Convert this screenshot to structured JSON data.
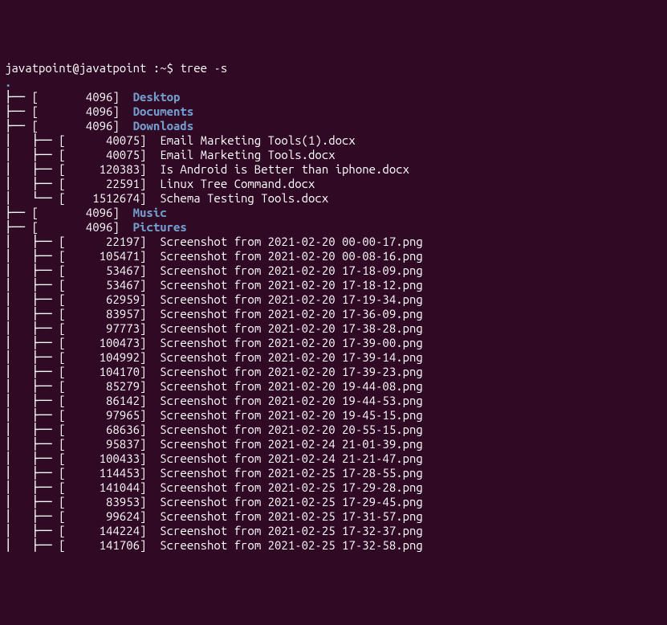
{
  "prompt": {
    "user": "javatpoint@javatpoint",
    "sep": " :",
    "path": "~",
    "dollar": "$ ",
    "command": "tree -s"
  },
  "root": ".",
  "tree": [
    {
      "prefix": "├── ",
      "size": "4096",
      "name": "Desktop",
      "type": "dir"
    },
    {
      "prefix": "├── ",
      "size": "4096",
      "name": "Documents",
      "type": "dir"
    },
    {
      "prefix": "├── ",
      "size": "4096",
      "name": "Downloads",
      "type": "dir"
    },
    {
      "prefix": "│   ├── ",
      "size": "40075",
      "name": "Email Marketing Tools(1).docx",
      "type": "file"
    },
    {
      "prefix": "│   ├── ",
      "size": "40075",
      "name": "Email Marketing Tools.docx",
      "type": "file"
    },
    {
      "prefix": "│   ├── ",
      "size": "120383",
      "name": "Is Android is Better than iphone.docx",
      "type": "file"
    },
    {
      "prefix": "│   ├── ",
      "size": "22591",
      "name": "Linux Tree Command.docx",
      "type": "file"
    },
    {
      "prefix": "│   └── ",
      "size": "1512674",
      "name": "Schema Testing Tools.docx",
      "type": "file"
    },
    {
      "prefix": "├── ",
      "size": "4096",
      "name": "Music",
      "type": "dir"
    },
    {
      "prefix": "├── ",
      "size": "4096",
      "name": "Pictures",
      "type": "dir"
    },
    {
      "prefix": "│   ├── ",
      "size": "22197",
      "name": "Screenshot from 2021-02-20 00-00-17.png",
      "type": "file"
    },
    {
      "prefix": "│   ├── ",
      "size": "105471",
      "name": "Screenshot from 2021-02-20 00-08-16.png",
      "type": "file"
    },
    {
      "prefix": "│   ├── ",
      "size": "53467",
      "name": "Screenshot from 2021-02-20 17-18-09.png",
      "type": "file"
    },
    {
      "prefix": "│   ├── ",
      "size": "53467",
      "name": "Screenshot from 2021-02-20 17-18-12.png",
      "type": "file"
    },
    {
      "prefix": "│   ├── ",
      "size": "62959",
      "name": "Screenshot from 2021-02-20 17-19-34.png",
      "type": "file"
    },
    {
      "prefix": "│   ├── ",
      "size": "83957",
      "name": "Screenshot from 2021-02-20 17-36-09.png",
      "type": "file"
    },
    {
      "prefix": "│   ├── ",
      "size": "97773",
      "name": "Screenshot from 2021-02-20 17-38-28.png",
      "type": "file"
    },
    {
      "prefix": "│   ├── ",
      "size": "100473",
      "name": "Screenshot from 2021-02-20 17-39-00.png",
      "type": "file"
    },
    {
      "prefix": "│   ├── ",
      "size": "104992",
      "name": "Screenshot from 2021-02-20 17-39-14.png",
      "type": "file"
    },
    {
      "prefix": "│   ├── ",
      "size": "104170",
      "name": "Screenshot from 2021-02-20 17-39-23.png",
      "type": "file"
    },
    {
      "prefix": "│   ├── ",
      "size": "85279",
      "name": "Screenshot from 2021-02-20 19-44-08.png",
      "type": "file"
    },
    {
      "prefix": "│   ├── ",
      "size": "86142",
      "name": "Screenshot from 2021-02-20 19-44-53.png",
      "type": "file"
    },
    {
      "prefix": "│   ├── ",
      "size": "97965",
      "name": "Screenshot from 2021-02-20 19-45-15.png",
      "type": "file"
    },
    {
      "prefix": "│   ├── ",
      "size": "68636",
      "name": "Screenshot from 2021-02-20 20-55-15.png",
      "type": "file"
    },
    {
      "prefix": "│   ├── ",
      "size": "95837",
      "name": "Screenshot from 2021-02-24 21-01-39.png",
      "type": "file"
    },
    {
      "prefix": "│   ├── ",
      "size": "100433",
      "name": "Screenshot from 2021-02-24 21-21-47.png",
      "type": "file"
    },
    {
      "prefix": "│   ├── ",
      "size": "114453",
      "name": "Screenshot from 2021-02-25 17-28-55.png",
      "type": "file"
    },
    {
      "prefix": "│   ├── ",
      "size": "141044",
      "name": "Screenshot from 2021-02-25 17-29-28.png",
      "type": "file"
    },
    {
      "prefix": "│   ├── ",
      "size": "83953",
      "name": "Screenshot from 2021-02-25 17-29-45.png",
      "type": "file"
    },
    {
      "prefix": "│   ├── ",
      "size": "99624",
      "name": "Screenshot from 2021-02-25 17-31-57.png",
      "type": "file"
    },
    {
      "prefix": "│   ├── ",
      "size": "144224",
      "name": "Screenshot from 2021-02-25 17-32-37.png",
      "type": "file"
    },
    {
      "prefix": "│   ├── ",
      "size": "141706",
      "name": "Screenshot from 2021-02-25 17-32-58.png",
      "type": "file"
    }
  ]
}
